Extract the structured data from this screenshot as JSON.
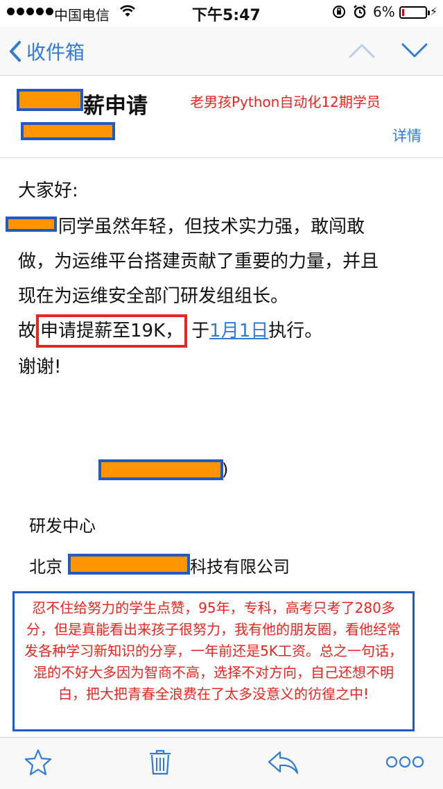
{
  "status_bar": {
    "carrier": "中国电信",
    "time": "下午5:47",
    "battery_percent": "6%",
    "battery_level": 0.06
  },
  "nav": {
    "back_label": "收件箱"
  },
  "email": {
    "subject_suffix": "薪申请",
    "details_label": "详情",
    "greeting": "大家好:",
    "line1": "同学虽然年轻，但技术实力强，敢闯敢",
    "line2": "做，为运维平台搭建贡献了重要的力量，并且",
    "line3": "现在为运维安全部门研发组组长。",
    "line4_prefix": "故",
    "line4_highlight": "申请提薪至19K，",
    "line4_mid": "于",
    "line4_date": "1月1日",
    "line4_suffix": "执行。",
    "thanks": "谢谢!",
    "signature": {
      "paren_close": ")",
      "department": "研发中心",
      "company_prefix": "北京",
      "company_suffix": "科技有限公司"
    }
  },
  "annotations": {
    "top_label": "老男孩Python自动化12期学员",
    "comment": "忍不住给努力的学生点赞，95年，专科，高考只考了280多分，但是真能看出来孩子很努力，我有他的朋友圈，看他经常发各种学习新知识的分享，一年前还是5K工资。总之一句话，混的不好大多因为智商不高，选择不对方向，自己还想不明白，把大把青春全浪费在了太多没意义的彷徨之中!"
  },
  "colors": {
    "accent": "#2f7bd6",
    "annotation_red": "#e8261f",
    "annotation_blue": "#1e5bc6",
    "redaction_fill": "#ff9500"
  },
  "icons": {
    "toolbar": [
      "star-icon",
      "trash-icon",
      "reply-icon",
      "more-icon"
    ]
  }
}
